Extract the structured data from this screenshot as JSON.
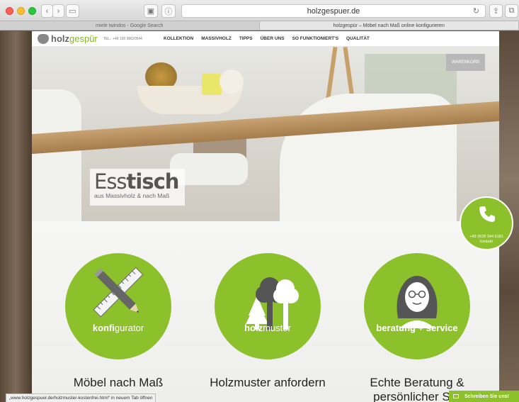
{
  "browser": {
    "url": "holzgespuer.de",
    "tabs": [
      "miele twindos - Google Search",
      "holzgespür – Möbel nach Maß online konfigurieren"
    ],
    "status_link": "„www.holzgespuer.de/holzmuster-kostenfrei.html“ in neuem Tab öffnen"
  },
  "site": {
    "logo_main": "holz",
    "logo_accent": "gespür",
    "phone_header": "TEL.: +49 160 96620544",
    "menu": [
      "KOLLEKTION",
      "MASSIVHOLZ",
      "TIPPS",
      "ÜBER UNS",
      "SO FUNKTIONIERT'S",
      "QUALITÄT"
    ],
    "cart_label": "WARENKORB"
  },
  "hero": {
    "title_light": "Ess",
    "title_bold": "tisch",
    "subtitle": "aus Massivholz & nach Maß"
  },
  "features": [
    {
      "label_bold": "konfi",
      "label_light": "gurator",
      "title": "Möbel nach Maß",
      "icon": "pencil-ruler-icon"
    },
    {
      "label_bold": "holz",
      "label_light": "muster",
      "title": "Holzmuster anfordern",
      "icon": "trees-icon"
    },
    {
      "label_bold": "beratung + service",
      "label_light": "",
      "title": "Echte Beratung & persönlicher Ser",
      "icon": "advisor-avatar-icon"
    }
  ],
  "contact": {
    "phone": "+49 2628 344 0181",
    "label": "kontakt"
  },
  "chat": {
    "label": "Schreiben Sie uns!"
  },
  "colors": {
    "accent": "#8cc12c"
  }
}
